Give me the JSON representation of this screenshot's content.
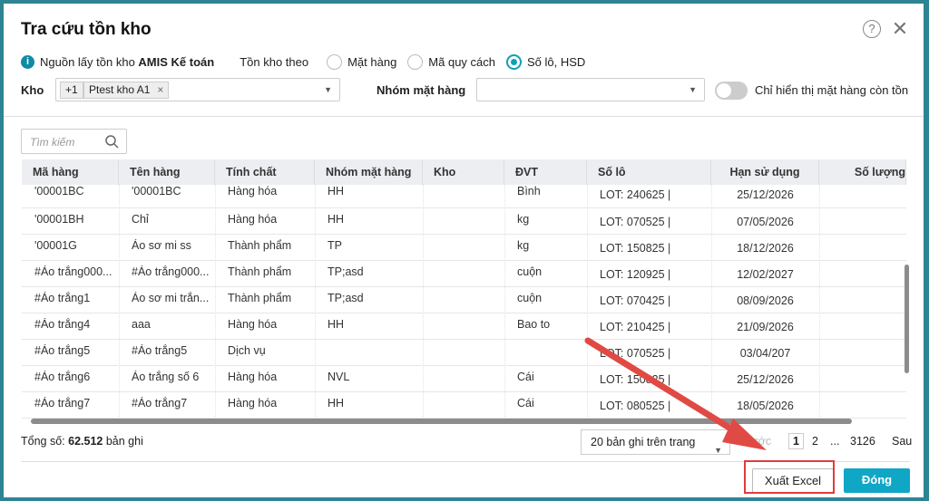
{
  "dialog": {
    "title": "Tra cứu tồn kho",
    "help_icon": "?",
    "close_icon": "✕"
  },
  "source": {
    "prefix": "Nguồn lấy tồn kho ",
    "name": "AMIS Kế toán"
  },
  "stock_by": {
    "label": "Tồn kho theo",
    "options": [
      "Mặt hàng",
      "Mã quy cách",
      "Số lô, HSD"
    ],
    "selected": "Số lô, HSD"
  },
  "warehouse": {
    "label": "Kho",
    "more": "+1",
    "chip": "Ptest kho A1"
  },
  "group": {
    "label": "Nhóm mặt hàng",
    "value": ""
  },
  "toggle": {
    "label": "Chỉ hiển thị mặt hàng còn tồn",
    "on": false
  },
  "search": {
    "placeholder": "Tìm kiếm"
  },
  "table": {
    "columns": [
      "Mã hàng",
      "Tên hàng",
      "Tính chất",
      "Nhóm mặt hàng",
      "Kho",
      "ĐVT",
      "Số lô",
      "Hạn sử dụng",
      "Số lượng"
    ],
    "rows": [
      [
        "'00001BC",
        "'00001BC",
        "Hàng hóa",
        "HH",
        "",
        "Bình",
        "LOT: 240625 |",
        "25/12/2026",
        ""
      ],
      [
        "'00001BH",
        "Chỉ",
        "Hàng hóa",
        "HH",
        "",
        "kg",
        "LOT: 070525 |",
        "07/05/2026",
        ""
      ],
      [
        "'00001G",
        "Áo sơ mi ss",
        "Thành phẩm",
        "TP",
        "",
        "kg",
        "LOT: 150825 |",
        "18/12/2026",
        ""
      ],
      [
        "#Áo trắng000...",
        "#Áo trắng000...",
        "Thành phẩm",
        "TP;asd",
        "",
        "cuộn",
        "LOT: 120925 |",
        "12/02/2027",
        ""
      ],
      [
        "#Áo trắng1",
        "Áo sơ mi trắn...",
        "Thành phẩm",
        "TP;asd",
        "",
        "cuộn",
        "LOT: 070425 |",
        "08/09/2026",
        ""
      ],
      [
        "#Áo trắng4",
        "aaa",
        "Hàng hóa",
        "HH",
        "",
        "Bao to",
        "LOT: 210425 |",
        "21/09/2026",
        ""
      ],
      [
        "#Áo trắng5",
        "#Áo trắng5",
        "Dịch vụ",
        "",
        "",
        "",
        "LOT: 070525 |",
        "03/04/207",
        ""
      ],
      [
        "#Áo trắng6",
        "Áo trắng số 6",
        "Hàng hóa",
        "NVL",
        "",
        "Cái",
        "LOT: 150825 |",
        "25/12/2026",
        ""
      ],
      [
        "#Áo trắng7",
        "#Áo trắng7",
        "Hàng hóa",
        "HH",
        "",
        "Cái",
        "LOT: 080525 |",
        "18/05/2026",
        ""
      ]
    ]
  },
  "footer": {
    "total_prefix": "Tổng số: ",
    "total": "62.512",
    "total_suffix": " bản ghi",
    "page_size": "20 bản ghi trên trang",
    "prev": "Trước",
    "pages": [
      "1",
      "2",
      "...",
      "3126"
    ],
    "next": "Sau"
  },
  "buttons": {
    "export": "Xuất Excel",
    "close": "Đóng"
  },
  "colors": {
    "accent": "#10a6c5",
    "annotation": "#e03c3c"
  }
}
